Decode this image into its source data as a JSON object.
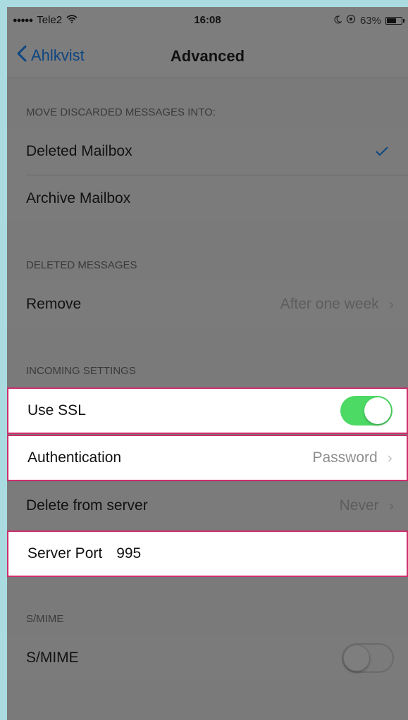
{
  "status_bar": {
    "signal": "●●●●●",
    "carrier": "Tele2",
    "wifi_icon": "wifi-icon",
    "time": "16:08",
    "battery_percent": "63%",
    "battery_level": 0.63
  },
  "nav": {
    "back_label": "Ahlkvist",
    "title": "Advanced"
  },
  "sections": {
    "discard_header": "MOVE DISCARDED MESSAGES INTO:",
    "deleted_mailbox": "Deleted Mailbox",
    "archive_mailbox": "Archive Mailbox",
    "deleted_header": "DELETED MESSAGES",
    "remove_label": "Remove",
    "remove_value": "After one week",
    "incoming_header": "INCOMING SETTINGS",
    "use_ssl_label": "Use SSL",
    "use_ssl_on": true,
    "auth_label": "Authentication",
    "auth_value": "Password",
    "delete_label": "Delete from server",
    "delete_value": "Never",
    "port_label": "Server Port",
    "port_value": "995",
    "smime_header": "S/MIME",
    "smime_label": "S/MIME",
    "smime_on": false
  },
  "colors": {
    "accent_blue": "#0e4680",
    "toggle_on": "#4cd964",
    "highlight_border": "#cc2f6c"
  }
}
